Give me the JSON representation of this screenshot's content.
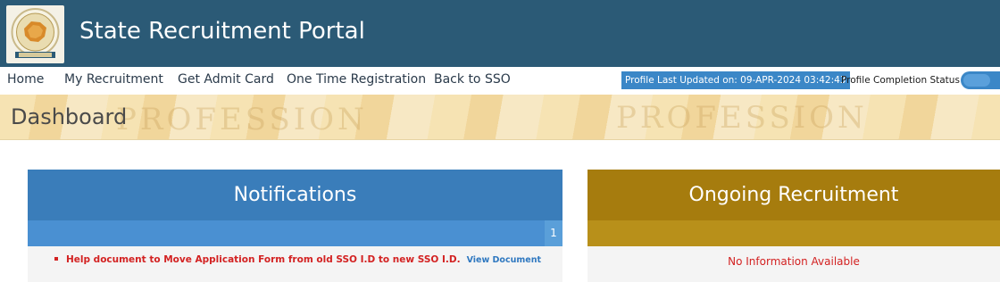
{
  "header": {
    "title": "State Recruitment Portal",
    "logo_icon": "state-emblem-icon",
    "bg_color": "#2b5a76"
  },
  "nav": {
    "items": [
      {
        "label": "Home"
      },
      {
        "label": "My Recruitment"
      },
      {
        "label": "Get Admit Card"
      },
      {
        "label": "One Time Registration"
      },
      {
        "label": "Back to SSO"
      }
    ],
    "profile_updated": "Profile Last Updated on: 09-APR-2024 03:42:43",
    "completion_label": "Profile Completion Status"
  },
  "banner": {
    "title": "Dashboard"
  },
  "notifications": {
    "title": "Notifications",
    "count": "1",
    "header_color": "#3a7dba",
    "items": [
      {
        "text": "Help document to Move Application Form from old SSO I.D to new SSO I.D.",
        "link": "View Document"
      }
    ]
  },
  "ongoing": {
    "title": "Ongoing Recruitment",
    "header_color": "#a67c0e",
    "empty_text": "No Information Available"
  }
}
